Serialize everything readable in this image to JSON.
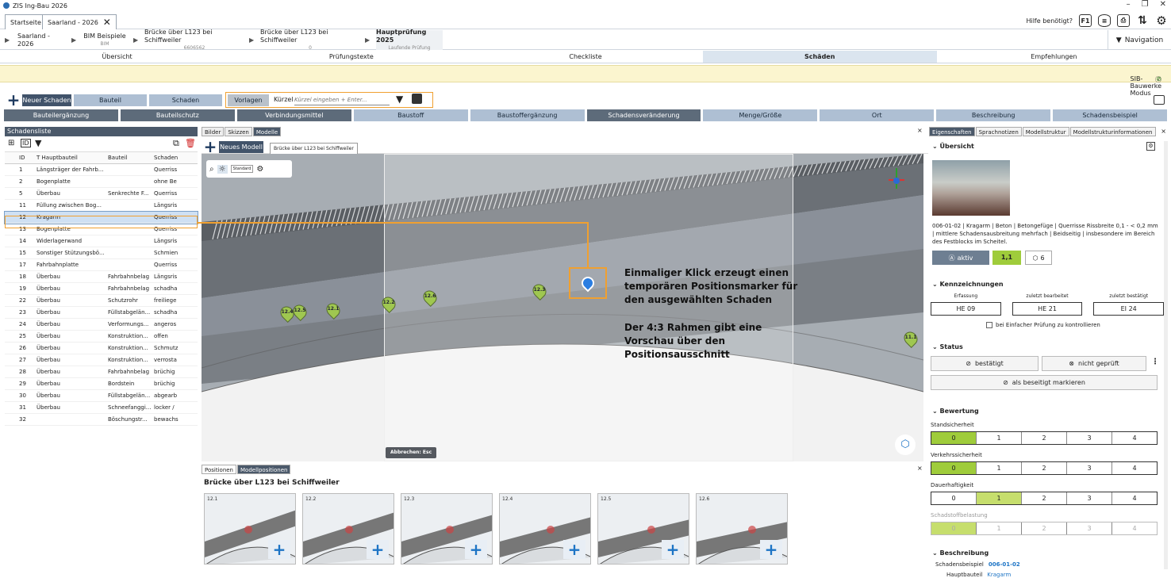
{
  "app": {
    "title": "ZIS Ing-Bau 2026"
  },
  "tabs": [
    {
      "label": "Startseite"
    },
    {
      "label": "Saarland - 2026"
    }
  ],
  "help": {
    "label": "Hilfe benötigt?",
    "f1": "F1"
  },
  "breadcrumb": [
    {
      "title": "Saarland - 2026",
      "sub": ""
    },
    {
      "title": "BIM Beispiele",
      "sub": "BIM"
    },
    {
      "title": "Brücke über L123 bei Schiffweiler",
      "sub": "6606562"
    },
    {
      "title": "Brücke über L123 bei Schiffweiler",
      "sub": "0"
    },
    {
      "title": "Hauptprüfung 2025",
      "sub": "Laufende Prüfung"
    }
  ],
  "navigation": {
    "label": "Navigation"
  },
  "main_tabs": [
    "Übersicht",
    "Prüfungstexte",
    "Checkliste",
    "Schäden",
    "Empfehlungen"
  ],
  "sib_mode": {
    "label": "SIB-Bauwerke Modus"
  },
  "toolbar": {
    "new_damage": "Neuer Schaden",
    "component": "Bauteil",
    "damage": "Schaden",
    "templates": "Vorlagen",
    "short_label": "Kürzel",
    "short_placeholder": "Kürzel eingeben + Enter..."
  },
  "categories": [
    "Bauteilergänzung",
    "Bauteilschutz",
    "Verbindungsmittel",
    "Baustoff",
    "Baustoffergänzung",
    "Schadensveränderung",
    "Menge/Größe",
    "Ort",
    "Beschreibung",
    "Schadensbeispiel"
  ],
  "damage_list": {
    "title": "Schadensliste",
    "columns": [
      "ID",
      "T",
      "Hauptbauteil",
      "T",
      "Bauteil",
      "T",
      "Schaden"
    ],
    "rows": [
      [
        "1",
        "Längsträger der Fahrb...",
        "",
        "Querriss"
      ],
      [
        "2",
        "Bogenplatte",
        "",
        "ohne Be"
      ],
      [
        "5",
        "Überbau",
        "Senkrechte F...",
        "Querriss"
      ],
      [
        "11",
        "Füllung zwischen Bog...",
        "",
        "Längsris"
      ],
      [
        "12",
        "Kragarm",
        "",
        "Querriss"
      ],
      [
        "13",
        "Bogenplatte",
        "",
        "Querriss"
      ],
      [
        "14",
        "Widerlagerwand",
        "",
        "Längsris"
      ],
      [
        "15",
        "Sonstiger Stützungsbö...",
        "",
        "Schmien"
      ],
      [
        "17",
        "Fahrbahnplatte",
        "",
        "Querriss"
      ],
      [
        "18",
        "Überbau",
        "Fahrbahnbelag",
        "Längsris"
      ],
      [
        "19",
        "Überbau",
        "Fahrbahnbelag",
        "schadha"
      ],
      [
        "22",
        "Überbau",
        "Schutzrohr",
        "freiliege"
      ],
      [
        "23",
        "Überbau",
        "Füllstabgelän...",
        "schadha"
      ],
      [
        "24",
        "Überbau",
        "Verformungs...",
        "angeros"
      ],
      [
        "25",
        "Überbau",
        "Konstruktion...",
        "offen"
      ],
      [
        "26",
        "Überbau",
        "Konstruktion...",
        "Schmutz"
      ],
      [
        "27",
        "Überbau",
        "Konstruktion...",
        "verrosta"
      ],
      [
        "28",
        "Überbau",
        "Fahrbahnbelag",
        "brüchig"
      ],
      [
        "29",
        "Überbau",
        "Bordstein",
        "brüchig"
      ],
      [
        "30",
        "Überbau",
        "Füllstabgelän...",
        "abgearb"
      ],
      [
        "31",
        "Überbau",
        "Schneefanggi...",
        "locker /"
      ],
      [
        "32",
        "",
        "Böschungstr...",
        "bewachs"
      ]
    ],
    "selected_id": "12"
  },
  "viewer": {
    "tabs": [
      "Bilder",
      "Skizzen",
      "Modelle"
    ],
    "new_model": "Neues Modell",
    "model_tab": "Brücke über L123 bei Schiffweiler",
    "mode": "Standard",
    "cancel": "Abbrechen: Esc",
    "markers": [
      "12.4",
      "12.5",
      "12.1",
      "12.2",
      "12.6",
      "12.3",
      "11.1"
    ],
    "annotation1": [
      "Einmaliger Klick erzeugt einen",
      "temporären Positionsmarker für",
      "den ausgewählten Schaden"
    ],
    "annotation2": [
      "Der 4:3 Rahmen gibt eine",
      "Vorschau über den",
      "Positionsausschnitt"
    ]
  },
  "positions": {
    "tabs": [
      "Positionen",
      "Modellpositionen"
    ],
    "title": "Brücke über L123 bei Schiffweiler",
    "thumbs": [
      "12.1",
      "12.2",
      "12.3",
      "12.4",
      "12.5",
      "12.6"
    ]
  },
  "props": {
    "tabs": [
      "Eigenschaften",
      "Sprachnotizen",
      "Modellstruktur",
      "Modellstrukturinformationen"
    ],
    "overview": "Übersicht",
    "description": "006-01-02 | Kragarm | Beton | Betongefüge | Querrisse Rissbreite 0,1 - < 0,2 mm | mittlere Schadensausbreitung mehrfach | Beidseitig | insbesondere im Bereich des Festblocks im Scheitel.",
    "active": "aktiv",
    "rating": "1,1",
    "models": "6",
    "ident_title": "Kennzeichnungen",
    "ident_labels": [
      "Erfassung",
      "zuletzt bearbeitet",
      "zuletzt bestätigt"
    ],
    "ident_values": [
      "HE 09",
      "HE 21",
      "EI 24"
    ],
    "check_label": "bei Einfacher Prüfung zu kontrollieren",
    "status_title": "Status",
    "confirmed": "bestätigt",
    "not_checked": "nicht geprüft",
    "mark_fixed": "als beseitigt markieren",
    "rating_title": "Bewertung",
    "scales": [
      {
        "label": "Standsicherheit",
        "active": 0
      },
      {
        "label": "Verkehrssicherheit",
        "active": 0
      },
      {
        "label": "Dauerhaftigkeit",
        "active": 1
      },
      {
        "label": "Schadstoffbelastung",
        "active": 0
      }
    ],
    "scale_values": [
      "0",
      "1",
      "2",
      "3",
      "4"
    ],
    "desc_title": "Beschreibung",
    "example_label": "Schadensbeispiel",
    "example_value": "006-01-02",
    "main_comp_label": "Hauptbauteil",
    "main_comp_value": "Kragarm"
  },
  "colors": {
    "accent": "#f0a030",
    "dark": "#41536a",
    "green": "#9fcc3b"
  }
}
